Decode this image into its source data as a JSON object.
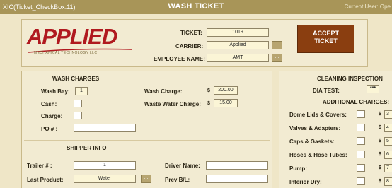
{
  "window": {
    "control_label": "XIC(Ticket_CheckBox.11)",
    "title": "WASH TICKET",
    "user_label": "Current User: Ope"
  },
  "logo": {
    "name": "APPLIED",
    "subtitle": "MECHANICAL TECHNOLOGY LLC"
  },
  "header": {
    "ticket_label": "TICKET:",
    "ticket_value": "1019",
    "carrier_label": "CARRIER:",
    "carrier_value": "Applied",
    "employee_label": "EMPLOYEE NAME:",
    "employee_value": "AMT",
    "ellipsis": "...",
    "accept_line1": "ACCEPT",
    "accept_line2": "TICKET"
  },
  "wash_charges": {
    "title": "WASH CHARGES",
    "wash_bay_label": "Wash Bay:",
    "wash_bay_value": "1",
    "cash_label": "Cash:",
    "charge_label": "Charge:",
    "po_label": "PO # :",
    "po_value": "",
    "wash_charge_label": "Wash Charge:",
    "wash_charge_value": "200.00",
    "waste_water_label": "Waste Water Charge:",
    "waste_water_value": "15.00",
    "currency": "$"
  },
  "shipper": {
    "title": "SHIPPER INFO",
    "trailer_label": "Trailer # :",
    "trailer_value": "1",
    "last_product_label": "Last Product:",
    "last_product_value": "Water",
    "driver_label": "Driver Name:",
    "driver_value": "",
    "prev_bl_label": "Prev B/L:",
    "prev_bl_value": ""
  },
  "cleaning": {
    "title": "CLEANING INSPECTION",
    "dia_test_label": "DIA TEST:",
    "dia_test_value": "***",
    "additional_title": "ADDITIONAL CHARGES:",
    "items": [
      {
        "label": "Dome Lids & Covers:",
        "amount": "3"
      },
      {
        "label": "Valves & Adapters:",
        "amount": "4"
      },
      {
        "label": "Caps & Gaskets:",
        "amount": "5"
      },
      {
        "label": "Hoses & Hose Tubes:",
        "amount": "6"
      },
      {
        "label": "Pump:",
        "amount": "7"
      },
      {
        "label": "Interior Dry:",
        "amount": "8"
      }
    ]
  }
}
